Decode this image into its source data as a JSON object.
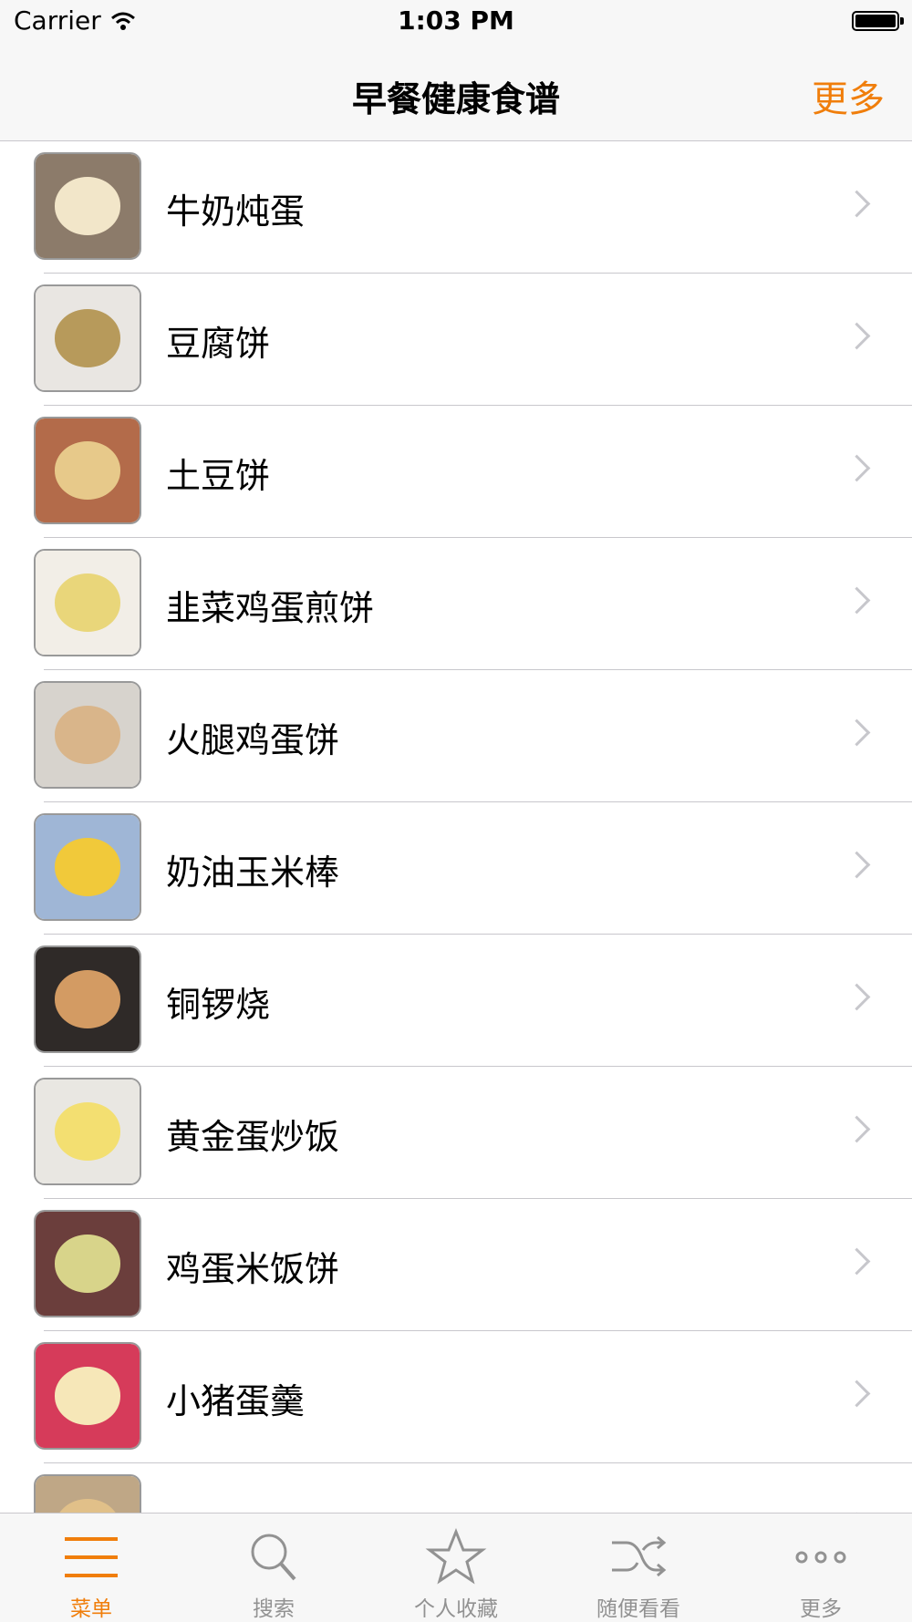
{
  "status_bar": {
    "carrier": "Carrier",
    "time": "1:03 PM"
  },
  "nav": {
    "title": "早餐健康食谱",
    "right_button": "更多"
  },
  "recipes": [
    {
      "name": "牛奶炖蛋",
      "thumb_colors": [
        "#8c7b6a",
        "#f2e6c9"
      ]
    },
    {
      "name": "豆腐饼",
      "thumb_colors": [
        "#e9e6e2",
        "#b79a5b"
      ]
    },
    {
      "name": "土豆饼",
      "thumb_colors": [
        "#b36b4a",
        "#e7c98a"
      ]
    },
    {
      "name": "韭菜鸡蛋煎饼",
      "thumb_colors": [
        "#f2eee7",
        "#e9d67a"
      ]
    },
    {
      "name": "火腿鸡蛋饼",
      "thumb_colors": [
        "#d7d3cd",
        "#d9b58a"
      ]
    },
    {
      "name": "奶油玉米棒",
      "thumb_colors": [
        "#9fb6d6",
        "#f1c93a"
      ]
    },
    {
      "name": "铜锣烧",
      "thumb_colors": [
        "#2f2a28",
        "#d39b63"
      ]
    },
    {
      "name": "黄金蛋炒饭",
      "thumb_colors": [
        "#e9e7e2",
        "#f3df71"
      ]
    },
    {
      "name": "鸡蛋米饭饼",
      "thumb_colors": [
        "#6b3e3c",
        "#d8d48a"
      ]
    },
    {
      "name": "小猪蛋羹",
      "thumb_colors": [
        "#d63b5a",
        "#f6e7b8"
      ]
    },
    {
      "name": "",
      "thumb_colors": [
        "#bfa786",
        "#e1c089"
      ]
    }
  ],
  "tabs": [
    {
      "label": "菜单",
      "icon": "menu-icon",
      "active": true
    },
    {
      "label": "搜索",
      "icon": "search-icon",
      "active": false
    },
    {
      "label": "个人收藏",
      "icon": "star-icon",
      "active": false
    },
    {
      "label": "随便看看",
      "icon": "shuffle-icon",
      "active": false
    },
    {
      "label": "更多",
      "icon": "more-icon",
      "active": false
    }
  ],
  "colors": {
    "accent": "#f07e0b",
    "inactive": "#929292"
  }
}
